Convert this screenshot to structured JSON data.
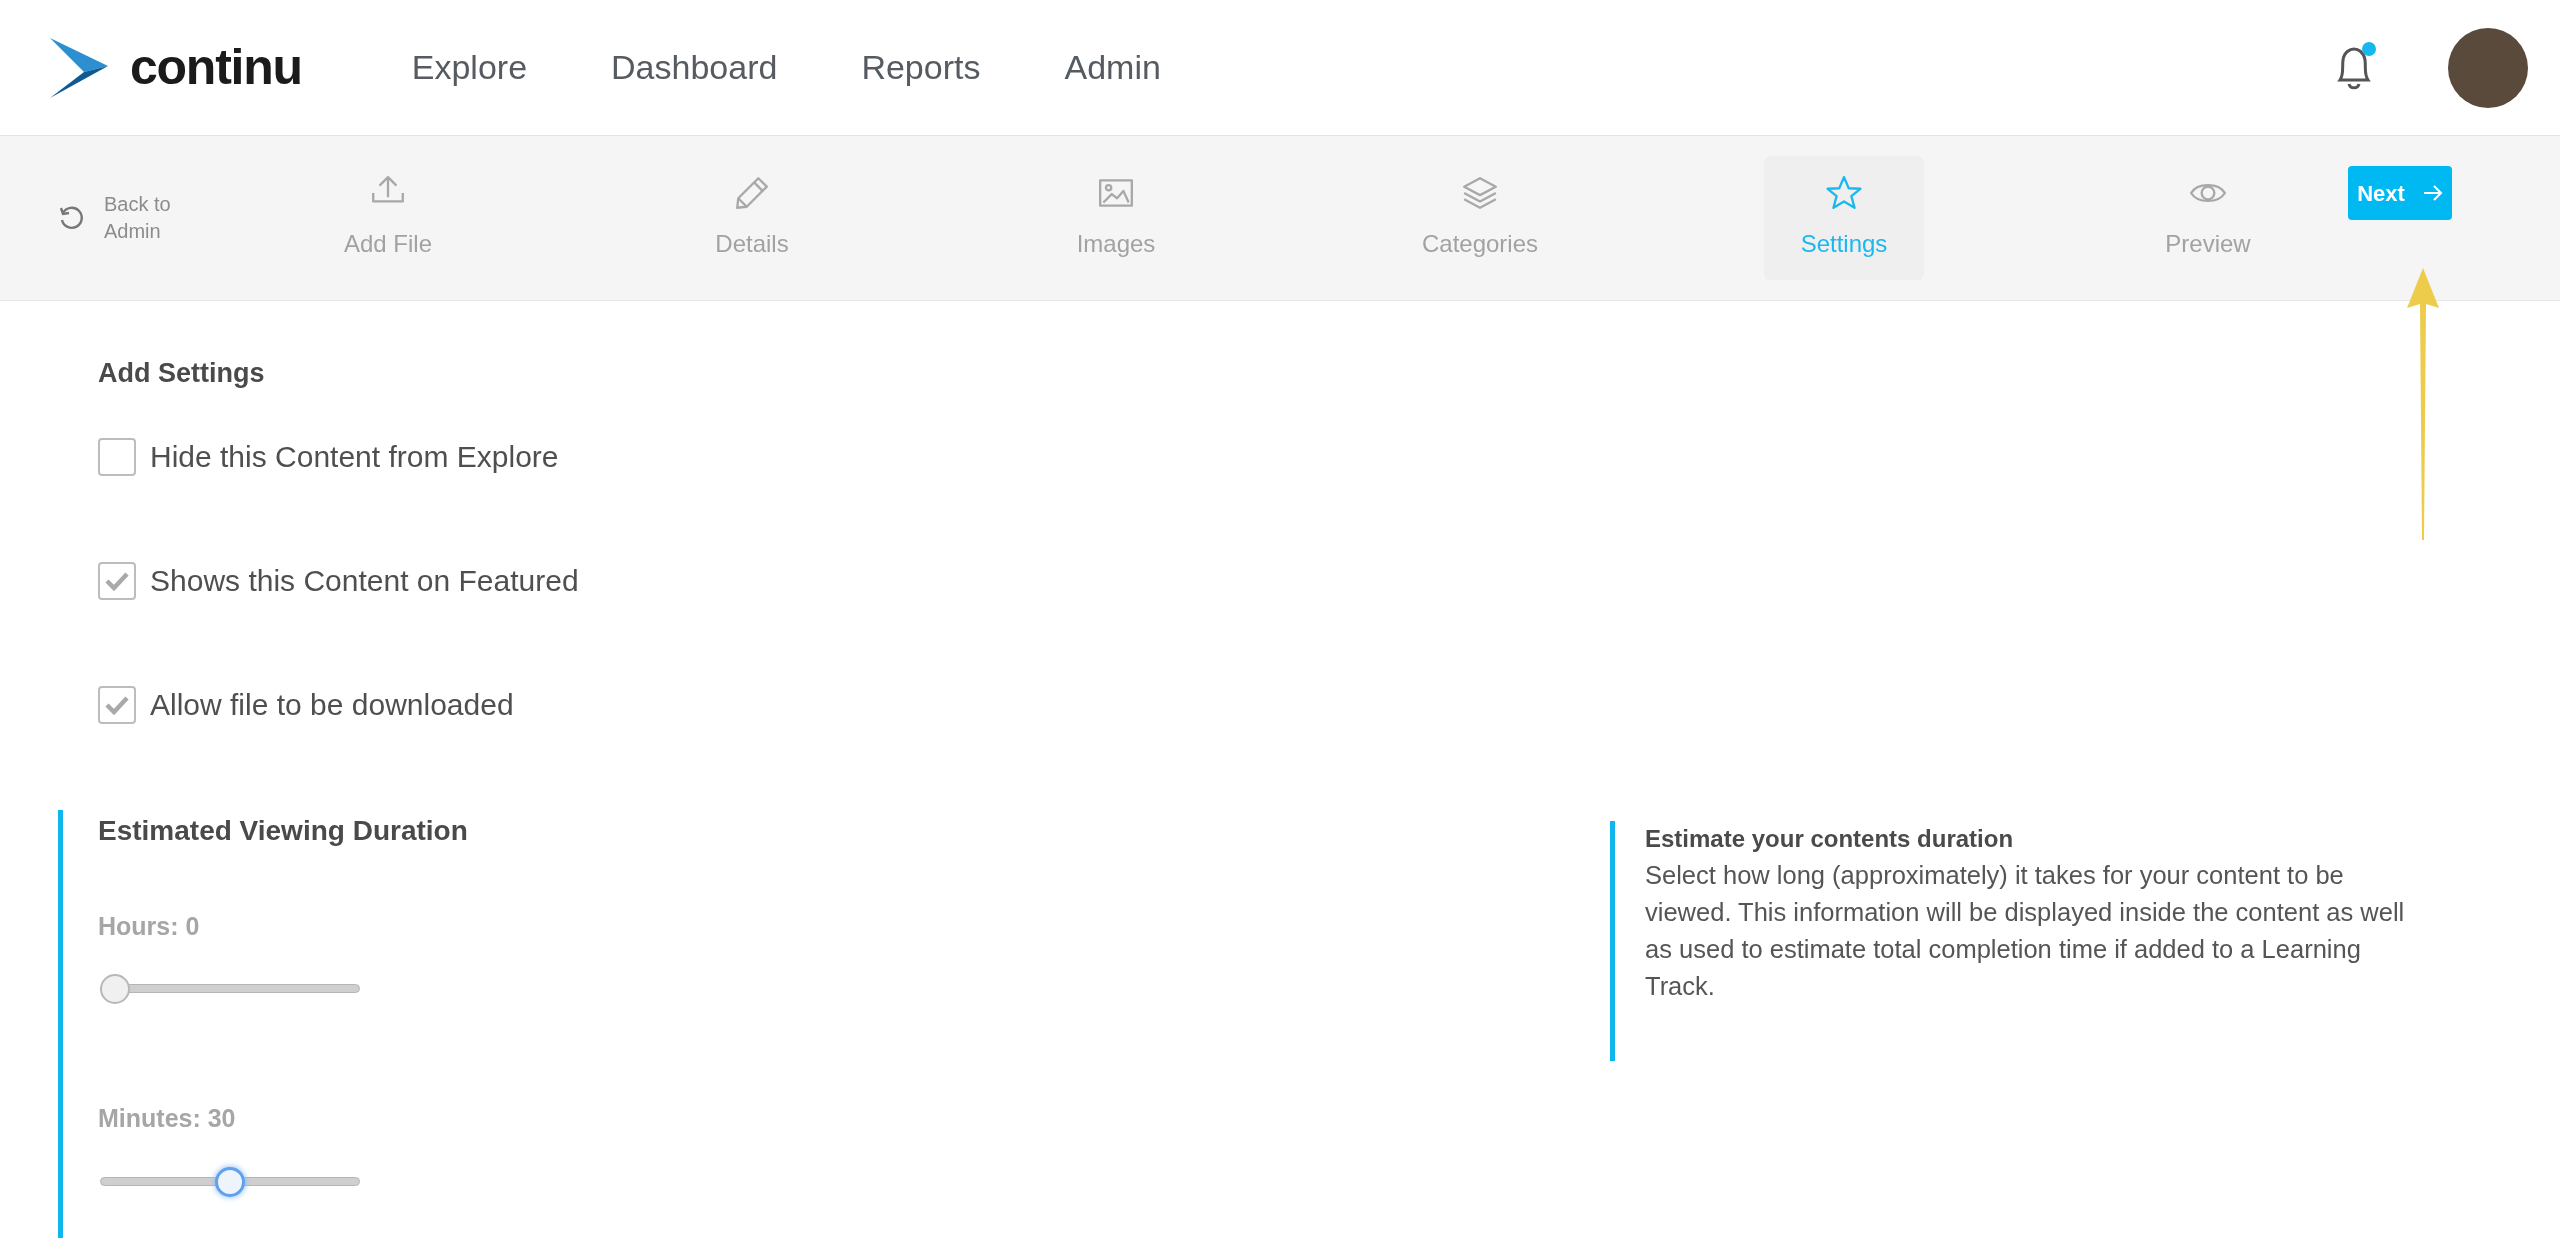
{
  "header": {
    "logo_text": "continu",
    "nav": [
      {
        "label": "Explore"
      },
      {
        "label": "Dashboard"
      },
      {
        "label": "Reports"
      },
      {
        "label": "Admin"
      }
    ],
    "notifications_unread": true
  },
  "steps_bar": {
    "back": {
      "label_lines": [
        "Back to",
        "Admin"
      ]
    },
    "steps": [
      {
        "kind": "upload",
        "label": "Add File",
        "selected": false
      },
      {
        "kind": "pencil",
        "label": "Details",
        "selected": false
      },
      {
        "kind": "image",
        "label": "Images",
        "selected": false
      },
      {
        "kind": "layers",
        "label": "Categories",
        "selected": false
      },
      {
        "kind": "star",
        "label": "Settings",
        "selected": true
      },
      {
        "kind": "eye",
        "label": "Preview",
        "selected": false
      }
    ],
    "next_button": "Next"
  },
  "settings": {
    "title": "Add Settings",
    "options": [
      {
        "label": "Hide this Content from Explore",
        "checked": false
      },
      {
        "label": "Shows this Content on Featured",
        "checked": true
      },
      {
        "label": "Allow file to be downloaded",
        "checked": true
      }
    ]
  },
  "duration": {
    "title": "Estimated Viewing Duration",
    "sliders": [
      {
        "label": "Hours: 0",
        "level": 0,
        "focused": false
      },
      {
        "label": "Minutes: 30",
        "level": 0.5,
        "focused": true
      }
    ]
  },
  "info": {
    "title": "Estimate your contents duration",
    "text": "Select how long (approximately) it takes for your content to be viewed. This information will be displayed inside the content as well as used to estimate total completion time if added to a Learning Track."
  }
}
